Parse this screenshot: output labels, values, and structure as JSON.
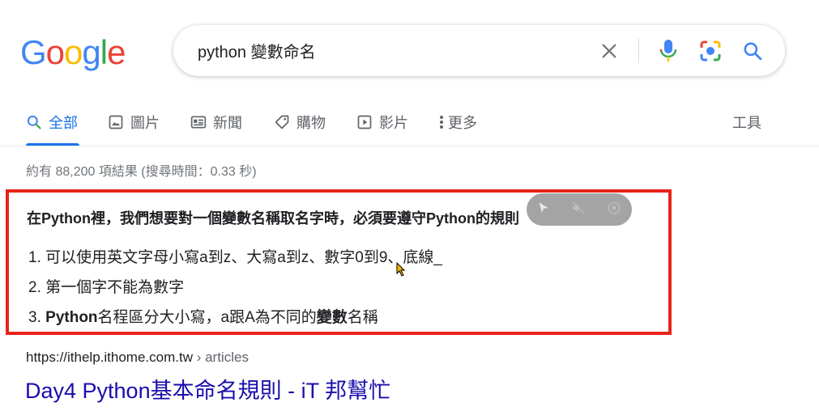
{
  "logo": {
    "letters": [
      "G",
      "o",
      "o",
      "g",
      "l",
      "e"
    ],
    "colors": [
      "#4285F4",
      "#EA4335",
      "#FBBC05",
      "#4285F4",
      "#34A853",
      "#EA4335"
    ]
  },
  "search": {
    "query": "python 變數命名"
  },
  "tabs": [
    {
      "label": "全部",
      "icon": "search-icon",
      "active": true
    },
    {
      "label": "圖片",
      "icon": "image-icon"
    },
    {
      "label": "新聞",
      "icon": "news-icon"
    },
    {
      "label": "購物",
      "icon": "tag-icon"
    },
    {
      "label": "影片",
      "icon": "play-icon"
    },
    {
      "label": "更多",
      "icon": "more-vert-icon"
    }
  ],
  "tools_label": "工具",
  "stats": "約有 88,200 項結果 (搜尋時間：0.33 秒)",
  "snippet": {
    "title": "在Python裡，我們想要對一個變數名稱取名字時，必須要遵守Python的規則",
    "items": [
      {
        "num": "1.",
        "text": "可以使用英文字母小寫a到z、大寫a到z、數字0到9、底線_"
      },
      {
        "num": "2.",
        "text": "第一個字不能為數字"
      },
      {
        "num": "3.",
        "bold1": "Python",
        "mid": "名程區分大小寫，a跟A為不同的",
        "bold2": "變數",
        "end": "名稱"
      }
    ]
  },
  "result": {
    "url_host": "https://ithelp.ithome.com.tw",
    "url_path": " › articles",
    "title": "Day4 Python基本命名規則 - iT 邦幫忙"
  }
}
